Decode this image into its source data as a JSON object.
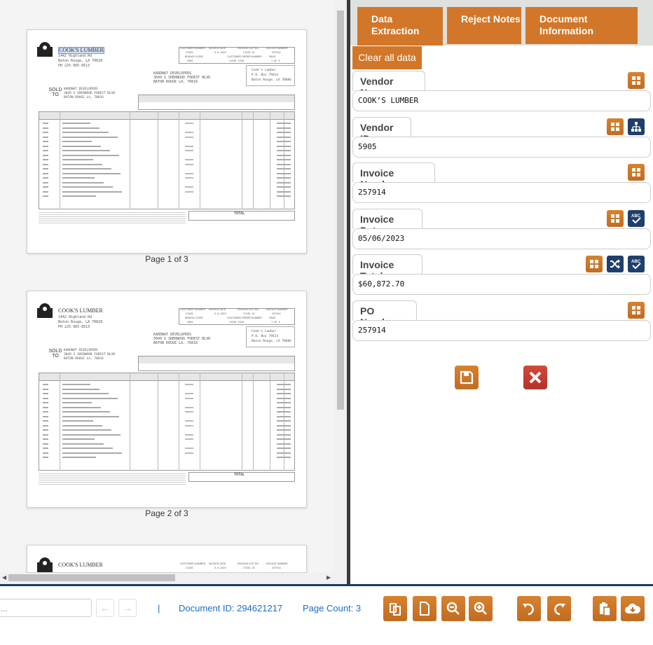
{
  "viewer": {
    "pages": [
      {
        "caption": "Page 1 of 3",
        "highlight": true
      },
      {
        "caption": "Page 2 of 3",
        "highlight": false
      },
      {
        "caption": "",
        "highlight": false
      }
    ],
    "invoice": {
      "company": "COOK'S LUMBER",
      "address": [
        "1442 Highland Rd",
        "Baton Rouge, LA 70820",
        "PH 225-965-8513"
      ],
      "ship_to": [
        "KARDNAT DEVELOPERS",
        "3049 S SHERWOOD FOREST BLVD",
        "BATON ROUGE LA, 70816"
      ],
      "sold_to_label": "SOLD TO",
      "remit": [
        "Cook's Lumber",
        "P.O. Box 79414",
        "Baton Rouge, LA 70884"
      ],
      "header_cols": [
        "CUSTOMER NUMBER",
        "INVOICE DATE",
        "PACKING LIST NO.",
        "INVOICE NUMBER"
      ],
      "header_vals": [
        "21345",
        "5-6-2023",
        "27432-31",
        "257914"
      ],
      "branch_cols": [
        "BRANCH CODE",
        "CUSTOMER ORDER NUMBER",
        "PAGE"
      ],
      "branch_vals": [
        "5905",
        "21345-2328",
        "1 OF 3"
      ],
      "total_label": "TOTAL"
    }
  },
  "tabs": [
    {
      "label": "Data Extraction"
    },
    {
      "label": "Reject Notes"
    },
    {
      "label": "Document Information"
    }
  ],
  "clear_label": "Clear all data",
  "fields": [
    {
      "label": "Vendor Name",
      "value": "COOK’S LUMBER",
      "icons": [
        "grid-icon"
      ]
    },
    {
      "label": "Vendor ID",
      "value": "5905",
      "icons": [
        "grid-icon",
        "hierarchy-icon"
      ]
    },
    {
      "label": "Invoice Number",
      "value": "257914",
      "icons": [
        "grid-icon"
      ]
    },
    {
      "label": "Invoice Date",
      "value": "05/06/2023",
      "icons": [
        "grid-icon",
        "spellcheck-icon"
      ]
    },
    {
      "label": "Invoice Total",
      "value": "$60,872.70",
      "icons": [
        "grid-icon",
        "shuffle-icon",
        "spellcheck-icon"
      ]
    },
    {
      "label": "PO Number",
      "value": "257914",
      "icons": [
        "grid-icon"
      ]
    }
  ],
  "bottom": {
    "page_input_placeholder": "...",
    "separator": "|",
    "document_id": "Document ID: 294621217",
    "page_count": "Page Count: 3"
  },
  "colors": {
    "accent": "#d2772a",
    "navy": "#1f3f6b",
    "danger": "#c0392b",
    "link": "#1a6fc4"
  }
}
